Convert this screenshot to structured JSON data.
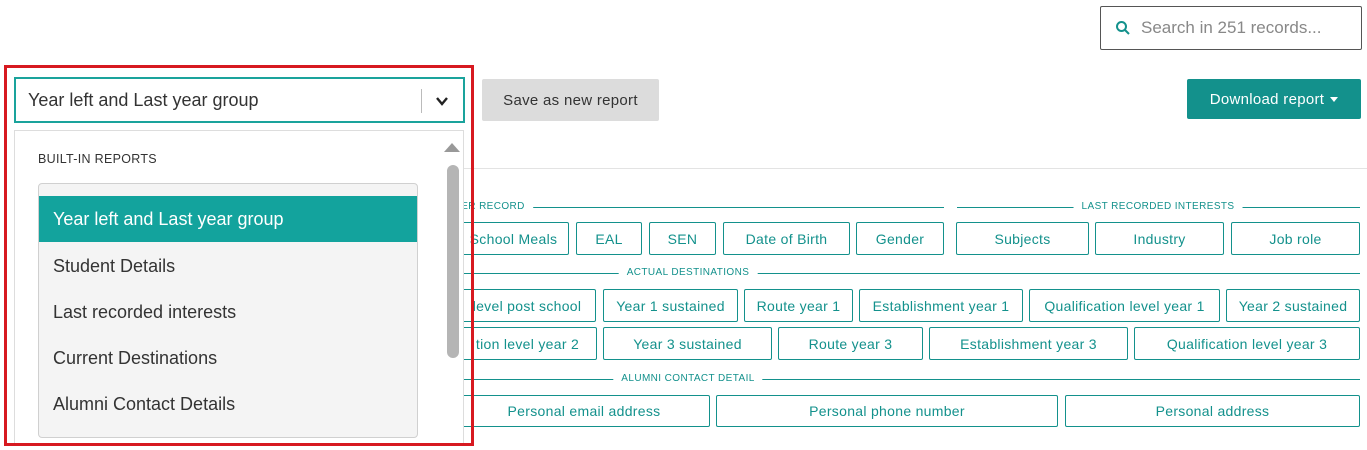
{
  "search": {
    "placeholder": "Search in 251 records..."
  },
  "toolbar": {
    "save_label": "Save as new report",
    "download_label": "Download report"
  },
  "report_select": {
    "selected": "Year left and Last year group",
    "heading": "BUILT-IN REPORTS",
    "options": [
      "Year left and Last year group",
      "Student Details",
      "Last recorded interests",
      "Current Destinations",
      "Alumni Contact Details"
    ]
  },
  "sections": {
    "record": {
      "label": "ER RECORD",
      "fields": [
        "School Meals",
        "EAL",
        "SEN",
        "Date of Birth",
        "Gender"
      ]
    },
    "interests": {
      "label": "LAST RECORDED INTERESTS",
      "fields": [
        "Subjects",
        "Industry",
        "Job role"
      ]
    },
    "destinations": {
      "label": "ACTUAL DESTINATIONS",
      "row1": [
        "level post school",
        "Year 1 sustained",
        "Route year 1",
        "Establishment year 1",
        "Qualification level year 1",
        "Year 2 sustained"
      ],
      "row2": [
        "tion level year 2",
        "Year 3 sustained",
        "Route year 3",
        "Establishment year 3",
        "Qualification level year 3"
      ]
    },
    "alumni": {
      "label": "ALUMNI CONTACT DETAIL",
      "fields": [
        "Personal email address",
        "Personal phone number",
        "Personal address"
      ]
    }
  },
  "colors": {
    "accent": "#13918c",
    "highlight": "#d71920",
    "active_item": "#13a39d"
  },
  "icons": {
    "search": "search-icon",
    "chevron": "chevron-down-icon",
    "caret": "caret-down-icon"
  }
}
